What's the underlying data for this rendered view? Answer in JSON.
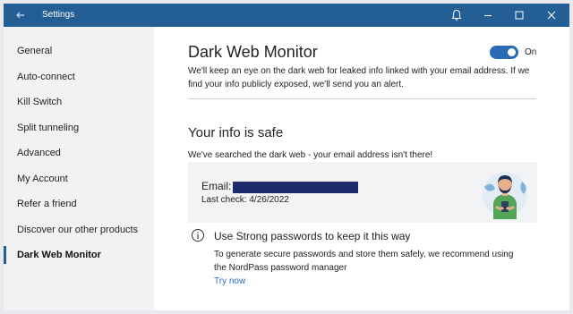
{
  "window": {
    "title": "Settings"
  },
  "titlebar_icons": [
    "back-arrow-icon",
    "bell-icon",
    "minimize-icon",
    "maximize-icon",
    "close-icon"
  ],
  "sidebar": {
    "items": [
      {
        "label": "General"
      },
      {
        "label": "Auto-connect"
      },
      {
        "label": "Kill Switch"
      },
      {
        "label": "Split tunneling"
      },
      {
        "label": "Advanced"
      },
      {
        "label": "My Account"
      },
      {
        "label": "Refer a friend"
      },
      {
        "label": "Discover our other products"
      },
      {
        "label": "Dark Web Monitor",
        "active": true
      }
    ]
  },
  "main": {
    "title": "Dark Web Monitor",
    "toggle": {
      "state": "on",
      "label": "On"
    },
    "description": "We'll keep an eye on the dark web for leaked info linked with your email address. If we find your info publicly exposed, we'll send you an alert.",
    "status_title": "Your info is safe",
    "searched_text": "We've searched the dark web - your email address isn't there!",
    "card": {
      "email_label": "Email:",
      "last_check": "Last check: 4/26/2022"
    },
    "tip": {
      "title": "Use Strong passwords to keep it this way",
      "text": "To generate secure passwords and store them safely, we recommend using the NordPass password manager",
      "link": "Try now"
    }
  },
  "colors": {
    "titlebar": "#235e94",
    "accent": "#2a6bb5",
    "redaction": "#1d2a6b"
  }
}
